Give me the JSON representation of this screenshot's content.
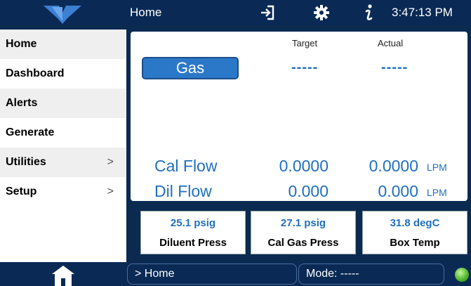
{
  "header": {
    "title": "Home",
    "clock": "3:47:13 PM"
  },
  "sidebar": {
    "items": [
      {
        "label": "Home"
      },
      {
        "label": "Dashboard"
      },
      {
        "label": "Alerts"
      },
      {
        "label": "Generate"
      },
      {
        "label": "Utilities",
        "chevron": ">"
      },
      {
        "label": "Setup",
        "chevron": ">"
      }
    ]
  },
  "main": {
    "target_header": "Target",
    "actual_header": "Actual",
    "gas_button": "Gas",
    "gas_target": "-----",
    "gas_actual": "-----",
    "cal_flow": {
      "label": "Cal Flow",
      "target": "0.0000",
      "actual": "0.0000",
      "unit": "LPM"
    },
    "dil_flow": {
      "label": "Dil Flow",
      "target": "0.000",
      "actual": "0.000",
      "unit": "LPM"
    }
  },
  "cards": [
    {
      "value": "25.1 psig",
      "label": "Diluent Press"
    },
    {
      "value": "27.1 psig",
      "label": "Cal Gas Press"
    },
    {
      "value": "31.8 degC",
      "label": "Box Temp"
    }
  ],
  "footer": {
    "breadcrumb": "> Home",
    "mode": "Mode: -----"
  },
  "colors": {
    "background": "#0b2a4f",
    "accent_blue": "#1f6fbf",
    "button_blue": "#2b78c8",
    "status_led": "#49b52a"
  },
  "icons": [
    "logo-icon",
    "sign-in-icon",
    "gear-icon",
    "info-icon",
    "home-icon",
    "status-led-icon"
  ]
}
